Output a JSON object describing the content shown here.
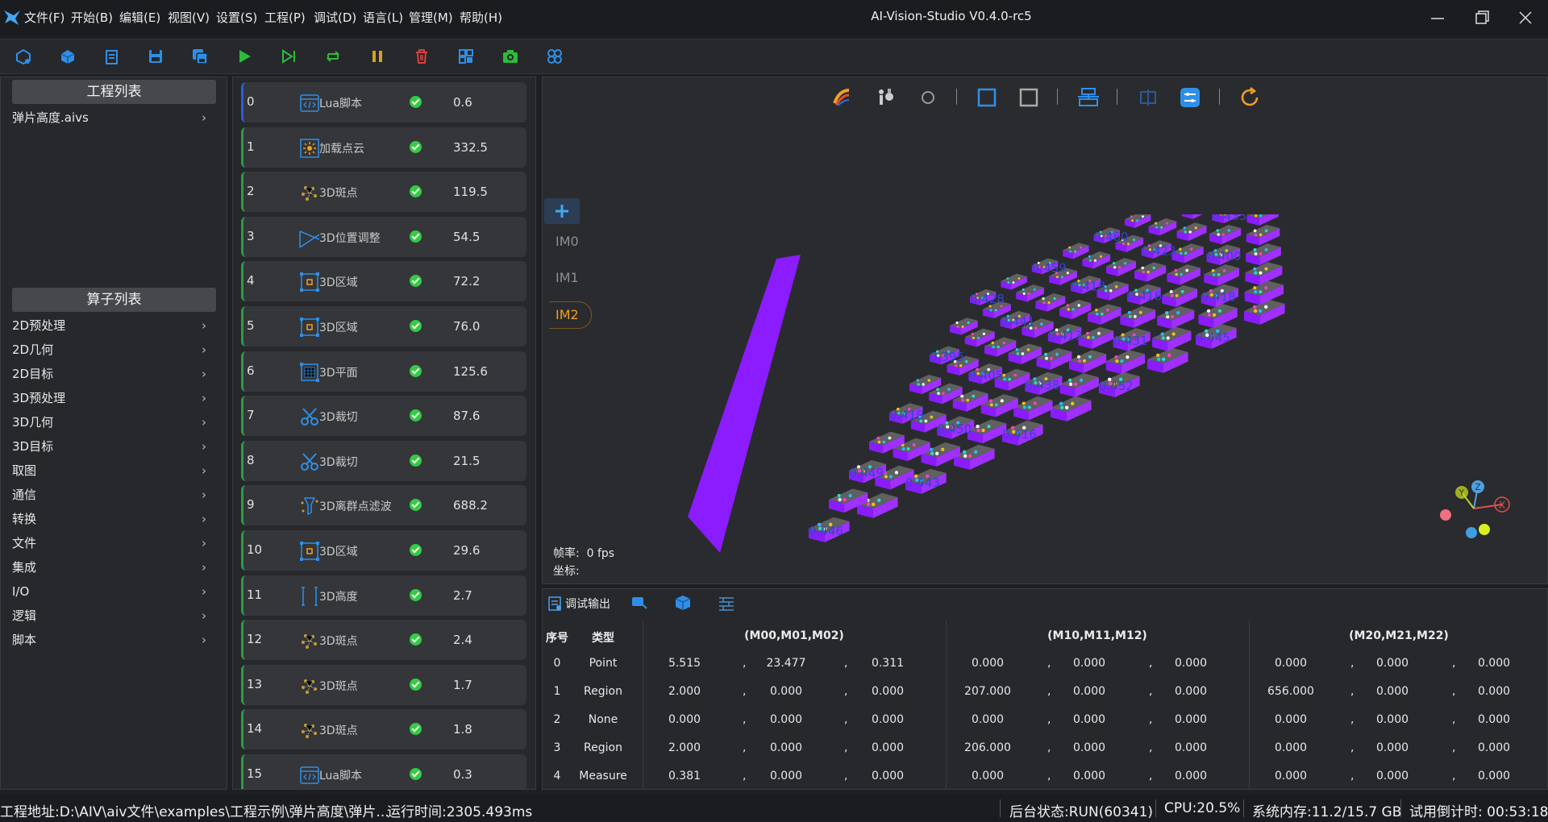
{
  "app": {
    "title": "AI-Vision-Studio V0.4.0-rc5",
    "menus": [
      "文件(F)",
      "开始(B)",
      "编辑(E)",
      "视图(V)",
      "设置(S)",
      "工程(P)",
      "调试(D)",
      "语言(L)",
      "管理(M)",
      "帮助(H)"
    ]
  },
  "toolbar": {
    "icons": [
      "open-project-icon",
      "new-project-icon",
      "edit-icon",
      "save-icon",
      "save-as-icon",
      "run-icon",
      "step-icon",
      "loop-icon",
      "pause-icon",
      "delete-icon",
      "layout-icon",
      "camera-icon",
      "grid-icon"
    ]
  },
  "project_panel": {
    "header": "工程列表",
    "items": [
      "弹片高度.aivs"
    ]
  },
  "operator_panel": {
    "header": "算子列表",
    "items": [
      "2D预处理",
      "2D几何",
      "2D目标",
      "3D预处理",
      "3D几何",
      "3D目标",
      "取图",
      "通信",
      "转换",
      "文件",
      "集成",
      "I/O",
      "逻辑",
      "脚本"
    ]
  },
  "nodes": [
    {
      "index": "0",
      "name": "Lua脚本",
      "icon": "script-icon",
      "time": "0.6"
    },
    {
      "index": "1",
      "name": "加载点云",
      "icon": "load-pointcloud-icon",
      "time": "332.5"
    },
    {
      "index": "2",
      "name": "3D斑点",
      "icon": "blob-icon",
      "time": "119.5"
    },
    {
      "index": "3",
      "name": "3D位置调整",
      "icon": "position-adjust-icon",
      "time": "54.5"
    },
    {
      "index": "4",
      "name": "3D区域",
      "icon": "region-icon",
      "time": "72.2"
    },
    {
      "index": "5",
      "name": "3D区域",
      "icon": "region-icon",
      "time": "76.0"
    },
    {
      "index": "6",
      "name": "3D平面",
      "icon": "plane-icon",
      "time": "125.6"
    },
    {
      "index": "7",
      "name": "3D裁切",
      "icon": "scissors-icon",
      "time": "87.6"
    },
    {
      "index": "8",
      "name": "3D裁切",
      "icon": "scissors-icon",
      "time": "21.5"
    },
    {
      "index": "9",
      "name": "3D离群点滤波",
      "icon": "outlier-filter-icon",
      "time": "688.2"
    },
    {
      "index": "10",
      "name": "3D区域",
      "icon": "region-icon",
      "time": "29.6"
    },
    {
      "index": "11",
      "name": "3D高度",
      "icon": "height-icon",
      "time": "2.7"
    },
    {
      "index": "12",
      "name": "3D斑点",
      "icon": "blob-icon",
      "time": "2.4"
    },
    {
      "index": "13",
      "name": "3D斑点",
      "icon": "blob-icon",
      "time": "1.7"
    },
    {
      "index": "14",
      "name": "3D斑点",
      "icon": "blob-icon",
      "time": "1.8"
    },
    {
      "index": "15",
      "name": "Lua脚本",
      "icon": "script-icon",
      "time": "0.3"
    }
  ],
  "viewer": {
    "image_tabs": [
      "IM0",
      "IM1",
      "IM2"
    ],
    "selected_tab": "IM2",
    "fps_label": "帧率:",
    "fps_value": "0 fps",
    "coord_label": "坐标:",
    "measure_labels": [
      "0.446",
      "0.443",
      "0.416",
      "0.452",
      "0.445",
      "0.449",
      "0.450",
      "0.438",
      "0.431",
      "0.418",
      "0.419",
      "0.405",
      "0.413",
      "0.416",
      "0.400",
      "0.395",
      "0.441",
      "0.418",
      "0.423",
      "0.433",
      "0.428",
      "0.459",
      "0.460",
      "0.466",
      "0.442",
      "0.436",
      "0.415",
      "0.421",
      "0.450",
      "0.385",
      "0.394",
      "0.376",
      "0.378"
    ],
    "axes": [
      "X",
      "Y",
      "Z"
    ]
  },
  "debug": {
    "tab_label": "调试输出",
    "headers": {
      "index": "序号",
      "type": "类型",
      "g0": "(M00,M01,M02)",
      "g1": "(M10,M11,M12)",
      "g2": "(M20,M21,M22)"
    },
    "rows": [
      {
        "index": "0",
        "type": "Point",
        "v": [
          "5.515",
          "23.477",
          "0.311",
          "0.000",
          "0.000",
          "0.000",
          "0.000",
          "0.000",
          "0.000"
        ]
      },
      {
        "index": "1",
        "type": "Region",
        "v": [
          "2.000",
          "0.000",
          "0.000",
          "207.000",
          "0.000",
          "0.000",
          "656.000",
          "0.000",
          "0.000"
        ]
      },
      {
        "index": "2",
        "type": "None",
        "v": [
          "0.000",
          "0.000",
          "0.000",
          "0.000",
          "0.000",
          "0.000",
          "0.000",
          "0.000",
          "0.000"
        ]
      },
      {
        "index": "3",
        "type": "Region",
        "v": [
          "2.000",
          "0.000",
          "0.000",
          "206.000",
          "0.000",
          "0.000",
          "0.000",
          "0.000",
          "0.000"
        ]
      },
      {
        "index": "4",
        "type": "Measure",
        "v": [
          "0.381",
          "0.000",
          "0.000",
          "0.000",
          "0.000",
          "0.000",
          "0.000",
          "0.000",
          "0.000"
        ]
      }
    ]
  },
  "status": {
    "path": "工程地址:D:\\AIV\\aiv文件\\examples\\工程示例\\弹片高度\\弹片...",
    "runtime": "运行时间:2305.493ms",
    "backend": "后台状态:RUN(60341)",
    "cpu": "CPU:20.5%",
    "memory": "系统内存:11.2/15.7 GB",
    "trial": "试用倒计时: 00:53:18"
  },
  "colors": {
    "accent": "#1e88e5",
    "run": "#2dbb3a",
    "pause": "#d8a020",
    "delete": "#d84040",
    "pointcloud": "#8a1cff",
    "selected_tab": "#f0a020"
  }
}
